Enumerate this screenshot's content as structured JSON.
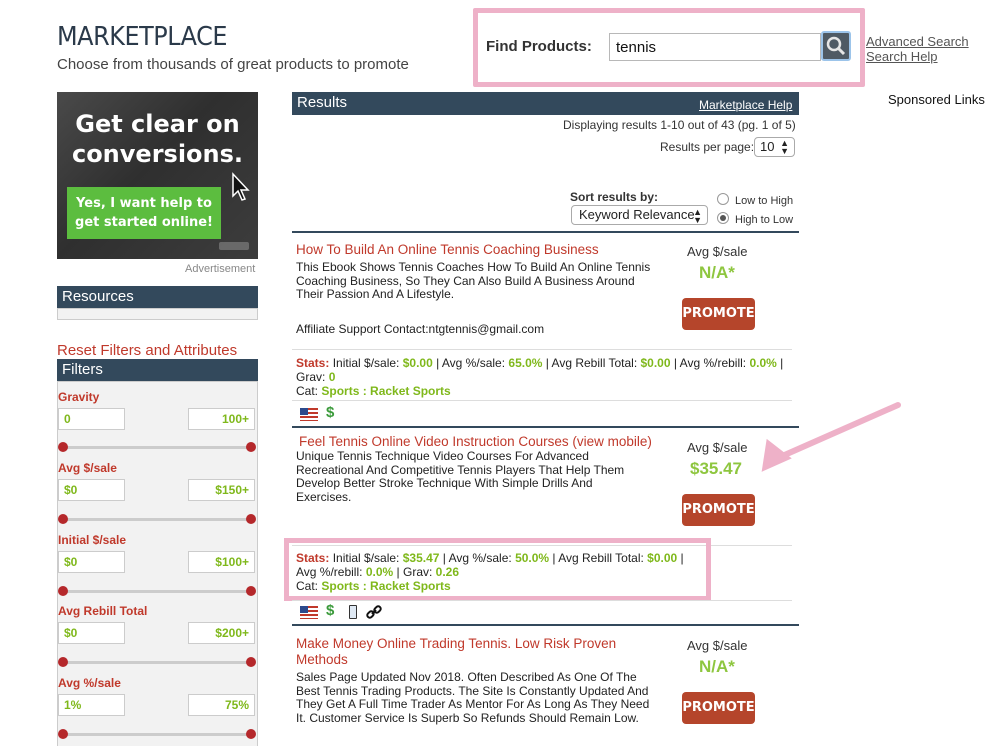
{
  "header": {
    "title": "MARKETPLACE",
    "subtitle": "Choose from thousands of great products to promote",
    "find_label": "Find Products:",
    "search_value": "tennis",
    "advanced_search": "Advanced Search",
    "search_help": "Search Help",
    "sponsored": "Sponsored Links"
  },
  "ad": {
    "headline": "Get clear on conversions.",
    "button": "Yes, I want help to get started online!",
    "caption": "Advertisement"
  },
  "sidebar": {
    "resources": "Resources",
    "reset": "Reset Filters and Attributes",
    "filters_title": "Filters",
    "filters": [
      {
        "label": "Gravity",
        "min": "0",
        "max": "100+"
      },
      {
        "label": "Avg $/sale",
        "min": "$0",
        "max": "$150+"
      },
      {
        "label": "Initial $/sale",
        "min": "$0",
        "max": "$100+"
      },
      {
        "label": "Avg Rebill Total",
        "min": "$0",
        "max": "$200+"
      },
      {
        "label": "Avg %/sale",
        "min": "1%",
        "max": "75%"
      }
    ]
  },
  "results": {
    "title": "Results",
    "help": "Marketplace Help",
    "displaying": "Displaying results 1-10 out of 43 (pg. 1 of 5)",
    "per_page_label": "Results per page:",
    "per_page_value": "10",
    "sort_label": "Sort results by:",
    "sort_value": "Keyword Relevance",
    "order_low": "Low to High",
    "order_high": "High to Low",
    "avg_label": "Avg $/sale",
    "promote": "PROMOTE",
    "items": [
      {
        "title": "How To Build An Online Tennis Coaching Business",
        "desc": "This Ebook Shows Tennis Coaches How To Build An Online Tennis Coaching Business, So They Can Also Build A Business Around Their Passion And A Lifestyle.",
        "affiliate": "Affiliate Support Contact:ntgtennis@gmail.com",
        "avg": "N/A*",
        "initial": "$0.00",
        "pct_sale": "65.0%",
        "rebill_total": "$0.00",
        "pct_rebill": "0.0%",
        "grav": "0",
        "cat": "Sports : Racket Sports"
      },
      {
        "title": "Feel Tennis Online Video Instruction Courses (view mobile)",
        "desc": "Unique Tennis Technique Video Courses For Advanced Recreational And Competitive Tennis Players That Help Them Develop Better Stroke Technique With Simple Drills And Exercises.",
        "avg": "$35.47",
        "initial": "$35.47",
        "pct_sale": "50.0%",
        "rebill_total": "$0.00",
        "pct_rebill": "0.0%",
        "grav": "0.26",
        "cat": "Sports : Racket Sports"
      },
      {
        "title": "Make Money Online Trading Tennis. Low Risk Proven Methods",
        "desc": "Sales Page Updated Nov 2018. Often Described As One Of The Best Tennis Trading Products. The Site Is Constantly Updated And They Get A Full Time Trader As Mentor For As Long As They Need It. Customer Service Is Superb So Refunds Should Remain Low.",
        "avg": "N/A*"
      }
    ],
    "stat_labels": {
      "stats": "Stats:",
      "initial": "Initial $/sale:",
      "pct_sale": "Avg %/sale:",
      "rebill_total": "Avg Rebill Total:",
      "pct_rebill": "Avg %/rebill:",
      "grav": "Grav:",
      "cat": "Cat:"
    }
  },
  "colors": {
    "header_bar": "#33495c",
    "title_red": "#c0392b",
    "green": "#7fb81b",
    "promote": "#b5452b",
    "highlight": "#eeb1c8"
  }
}
